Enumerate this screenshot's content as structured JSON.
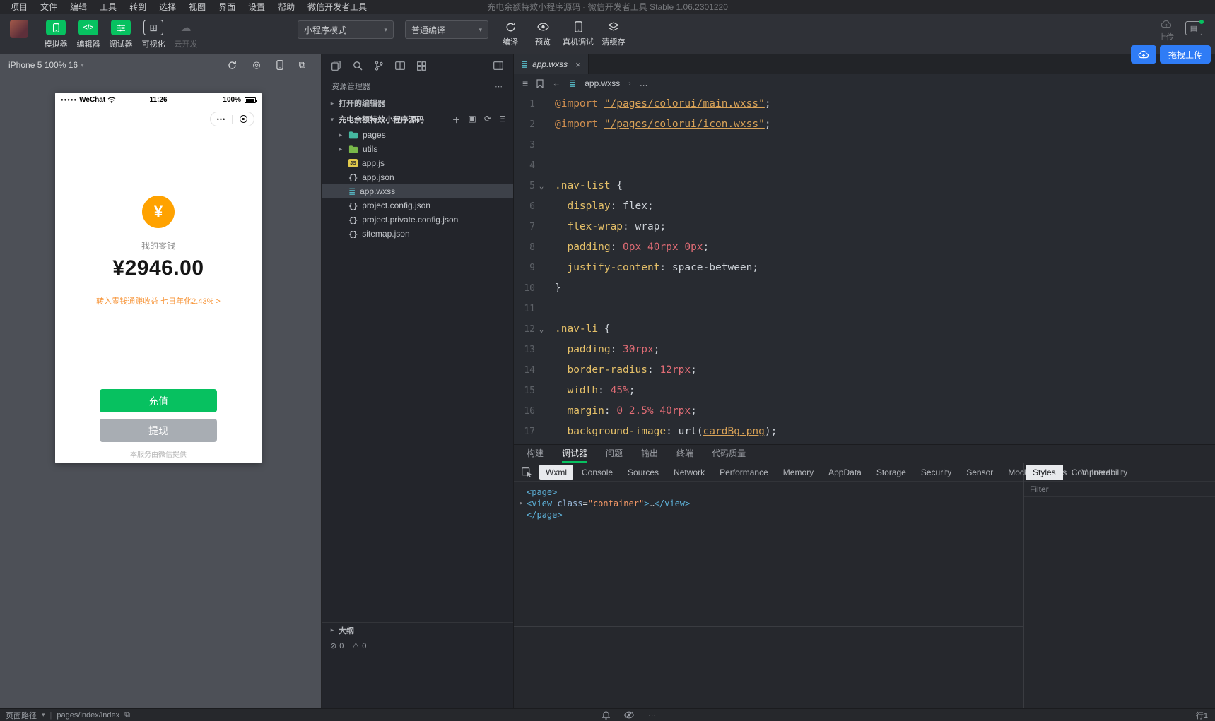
{
  "menubar": {
    "items": [
      "项目",
      "文件",
      "编辑",
      "工具",
      "转到",
      "选择",
      "视图",
      "界面",
      "设置",
      "帮助",
      "微信开发者工具"
    ],
    "title": "充电余额特效小程序源码 - 微信开发者工具 Stable 1.06.2301220"
  },
  "toolbar": {
    "main_buttons": [
      {
        "label": "模拟器",
        "state": "on"
      },
      {
        "label": "编辑器",
        "state": "on"
      },
      {
        "label": "调试器",
        "state": "on"
      },
      {
        "label": "可视化",
        "state": "off"
      },
      {
        "label": "云开发",
        "state": "disabled"
      }
    ],
    "mode_dropdown": "小程序模式",
    "compile_dropdown": "普通编译",
    "action_buttons": [
      "编译",
      "预览",
      "真机调试",
      "清缓存"
    ],
    "upload_label": "上传",
    "drag_upload_label": "拖拽上传"
  },
  "simulator": {
    "device_label": "iPhone 5 100% 16",
    "phone": {
      "carrier_dots": "●●●●●",
      "carrier": "WeChat",
      "time": "11:26",
      "battery": "100%",
      "capsule_dots": "•••",
      "wallet_label": "我的零钱",
      "balance": "¥2946.00",
      "promo": "转入零钱通赚收益 七日年化2.43% >",
      "recharge_button": "充值",
      "withdraw_button": "提现",
      "footer": "本服务由微信提供"
    }
  },
  "explorer": {
    "header": "资源管理器",
    "open_editors": "打开的编辑器",
    "project_name": "充电余额特效小程序源码",
    "files": [
      {
        "name": "pages",
        "type": "folder",
        "expandable": true
      },
      {
        "name": "utils",
        "type": "folder",
        "expandable": true
      },
      {
        "name": "app.js",
        "type": "js"
      },
      {
        "name": "app.json",
        "type": "json"
      },
      {
        "name": "app.wxss",
        "type": "wxss",
        "selected": true
      },
      {
        "name": "project.config.json",
        "type": "json"
      },
      {
        "name": "project.private.config.json",
        "type": "json"
      },
      {
        "name": "sitemap.json",
        "type": "json"
      }
    ],
    "outline_label": "大纲",
    "error_count": "0",
    "warning_count": "0"
  },
  "editor": {
    "tab_title": "app.wxss",
    "breadcrumb_file": "app.wxss",
    "breadcrumb_more": "…",
    "lines": [
      {
        "n": 1,
        "tokens": [
          [
            "kw",
            "@import"
          ],
          [
            "pun",
            " "
          ],
          [
            "str",
            "\"/pages/colorui/main.wxss\""
          ],
          [
            "pun",
            ";"
          ]
        ]
      },
      {
        "n": 2,
        "tokens": [
          [
            "kw",
            "@import"
          ],
          [
            "pun",
            " "
          ],
          [
            "str",
            "\"/pages/colorui/icon.wxss\""
          ],
          [
            "pun",
            ";"
          ]
        ]
      },
      {
        "n": 3,
        "tokens": []
      },
      {
        "n": 4,
        "tokens": []
      },
      {
        "n": 5,
        "fold": true,
        "tokens": [
          [
            "sel",
            ".nav-list"
          ],
          [
            "pun",
            " {"
          ]
        ]
      },
      {
        "n": 6,
        "tokens": [
          [
            "pun",
            "  "
          ],
          [
            "prop",
            "display"
          ],
          [
            "pun",
            ": "
          ],
          [
            "val",
            "flex"
          ],
          [
            "pun",
            ";"
          ]
        ]
      },
      {
        "n": 7,
        "tokens": [
          [
            "pun",
            "  "
          ],
          [
            "prop",
            "flex-wrap"
          ],
          [
            "pun",
            ": "
          ],
          [
            "val",
            "wrap"
          ],
          [
            "pun",
            ";"
          ]
        ]
      },
      {
        "n": 8,
        "tokens": [
          [
            "pun",
            "  "
          ],
          [
            "prop",
            "padding"
          ],
          [
            "pun",
            ": "
          ],
          [
            "num",
            "0px 40rpx 0px"
          ],
          [
            "pun",
            ";"
          ]
        ]
      },
      {
        "n": 9,
        "tokens": [
          [
            "pun",
            "  "
          ],
          [
            "prop",
            "justify-content"
          ],
          [
            "pun",
            ": "
          ],
          [
            "val",
            "space-between"
          ],
          [
            "pun",
            ";"
          ]
        ]
      },
      {
        "n": 10,
        "tokens": [
          [
            "pun",
            "}"
          ]
        ]
      },
      {
        "n": 11,
        "tokens": []
      },
      {
        "n": 12,
        "fold": true,
        "tokens": [
          [
            "sel",
            ".nav-li"
          ],
          [
            "pun",
            " {"
          ]
        ]
      },
      {
        "n": 13,
        "tokens": [
          [
            "pun",
            "  "
          ],
          [
            "prop",
            "padding"
          ],
          [
            "pun",
            ": "
          ],
          [
            "num",
            "30rpx"
          ],
          [
            "pun",
            ";"
          ]
        ]
      },
      {
        "n": 14,
        "tokens": [
          [
            "pun",
            "  "
          ],
          [
            "prop",
            "border-radius"
          ],
          [
            "pun",
            ": "
          ],
          [
            "num",
            "12rpx"
          ],
          [
            "pun",
            ";"
          ]
        ]
      },
      {
        "n": 15,
        "tokens": [
          [
            "pun",
            "  "
          ],
          [
            "prop",
            "width"
          ],
          [
            "pun",
            ": "
          ],
          [
            "num",
            "45%"
          ],
          [
            "pun",
            ";"
          ]
        ]
      },
      {
        "n": 16,
        "tokens": [
          [
            "pun",
            "  "
          ],
          [
            "prop",
            "margin"
          ],
          [
            "pun",
            ": "
          ],
          [
            "num",
            "0 2.5% 40rpx"
          ],
          [
            "pun",
            ";"
          ]
        ]
      },
      {
        "n": 17,
        "tokens": [
          [
            "pun",
            "  "
          ],
          [
            "prop",
            "background-image"
          ],
          [
            "pun",
            ": "
          ],
          [
            "val",
            "url("
          ],
          [
            "str",
            "cardBg.png"
          ],
          [
            "val",
            ");"
          ]
        ]
      }
    ]
  },
  "debug": {
    "panel_tabs": [
      "构建",
      "调试器",
      "问题",
      "输出",
      "终端",
      "代码质量"
    ],
    "active_panel_tab": "调试器",
    "devtools_tabs": [
      "Wxml",
      "Console",
      "Sources",
      "Network",
      "Performance",
      "Memory",
      "AppData",
      "Storage",
      "Security",
      "Sensor",
      "Mock",
      "Audits",
      "Vulnerability"
    ],
    "active_devtools_tab": "Wxml",
    "wxml_lines": [
      {
        "tokens": [
          [
            "wtag",
            "<page>"
          ]
        ]
      },
      {
        "arrow": true,
        "tokens": [
          [
            "wtag",
            "<view"
          ],
          [
            "wpun",
            " "
          ],
          [
            "wattr",
            "class"
          ],
          [
            "wpun",
            "="
          ],
          [
            "wstr",
            "\"container\""
          ],
          [
            "wtag",
            ">"
          ],
          [
            "wpun",
            "…"
          ],
          [
            "wtag",
            "</view>"
          ]
        ]
      },
      {
        "tokens": [
          [
            "wtag",
            "</page>"
          ]
        ]
      }
    ],
    "styles_tabs": [
      "Styles",
      "Computed"
    ],
    "active_styles_tab": "Styles",
    "filter_label": "Filter"
  },
  "statusbar": {
    "left_label": "页面路径",
    "page_path": "pages/index/index",
    "line_info": "行1"
  }
}
